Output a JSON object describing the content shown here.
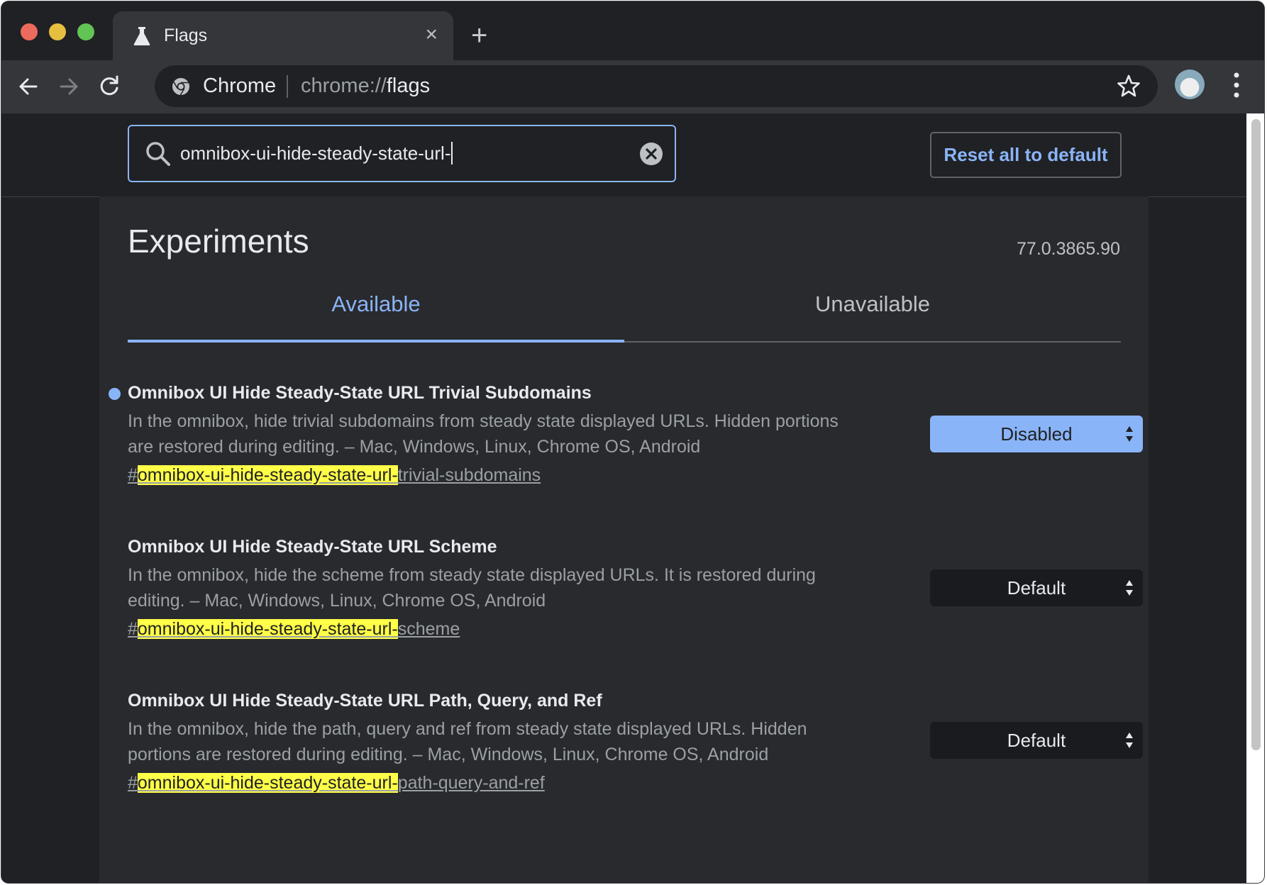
{
  "tab": {
    "title": "Flags",
    "close_glyph": "×",
    "icon": "flask-icon"
  },
  "new_tab_glyph": "+",
  "omnibox": {
    "site_name": "Chrome",
    "url_scheme": "chrome://",
    "url_host": "flags"
  },
  "search": {
    "value": "omnibox-ui-hide-steady-state-url-"
  },
  "reset_button": "Reset all to default",
  "page": {
    "title": "Experiments",
    "version": "77.0.3865.90"
  },
  "tabs": [
    {
      "label": "Available",
      "active": true
    },
    {
      "label": "Unavailable",
      "active": false
    }
  ],
  "experiments": [
    {
      "title": "Omnibox UI Hide Steady-State URL Trivial Subdomains",
      "description": "In the omnibox, hide trivial subdomains from steady state displayed URLs. Hidden portions are restored during editing. – Mac, Windows, Linux, Chrome OS, Android",
      "link_prefix": "#",
      "link_match": "omnibox-ui-hide-steady-state-url-",
      "link_rest": "trivial-subdomains",
      "value": "Disabled",
      "modified": true
    },
    {
      "title": "Omnibox UI Hide Steady-State URL Scheme",
      "description": "In the omnibox, hide the scheme from steady state displayed URLs. It is restored during editing. – Mac, Windows, Linux, Chrome OS, Android",
      "link_prefix": "#",
      "link_match": "omnibox-ui-hide-steady-state-url-",
      "link_rest": "scheme",
      "value": "Default",
      "modified": false
    },
    {
      "title": "Omnibox UI Hide Steady-State URL Path, Query, and Ref",
      "description": "In the omnibox, hide the path, query and ref from steady state displayed URLs. Hidden portions are restored during editing. – Mac, Windows, Linux, Chrome OS, Android",
      "link_prefix": "#",
      "link_match": "omnibox-ui-hide-steady-state-url-",
      "link_rest": "path-query-and-ref",
      "value": "Default",
      "modified": false
    }
  ],
  "colors": {
    "accent": "#8ab4f8",
    "highlight": "#ffff48",
    "background": "#202124",
    "content_background": "#292a2d"
  }
}
